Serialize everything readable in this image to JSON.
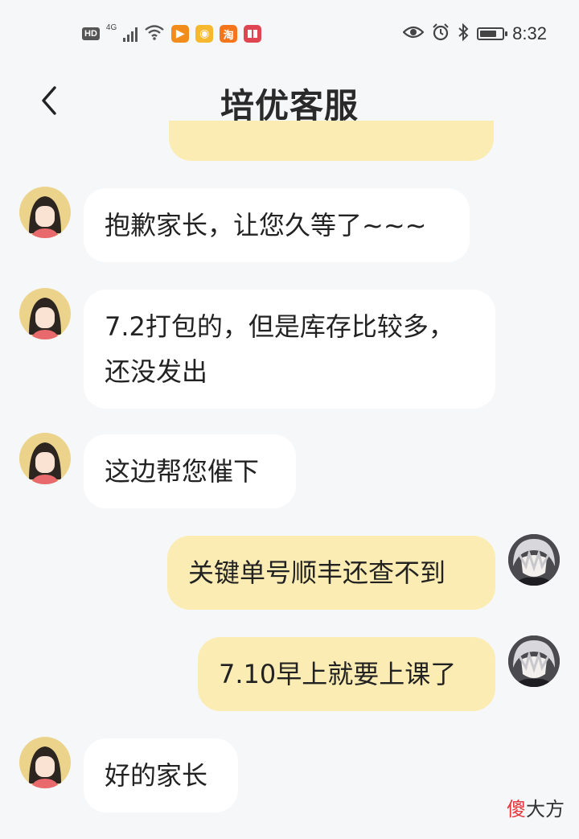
{
  "status_bar": {
    "hd_label": "HD",
    "network_label": "4G",
    "app_icons": [
      {
        "name": "video-app-icon",
        "color": "#f28c1b",
        "glyph": "▶"
      },
      {
        "name": "weibo-icon",
        "color": "#f5b82e",
        "glyph": "◉"
      },
      {
        "name": "taobao-icon",
        "color": "#f5761a",
        "glyph": "淘"
      },
      {
        "name": "reader-app-icon",
        "color": "#e04552",
        "glyph": "▮"
      }
    ],
    "time": "8:32"
  },
  "header": {
    "title": "培优客服",
    "back_icon": "chevron-left-icon"
  },
  "messages": [
    {
      "side": "left",
      "text": "抱歉家长，让您久等了~~~"
    },
    {
      "side": "left",
      "text": "7.2打包的，但是库存比较多，还没发出"
    },
    {
      "side": "left",
      "text": "这边帮您催下"
    },
    {
      "side": "right",
      "text": "关键单号顺丰还查不到"
    },
    {
      "side": "right",
      "text": "7.10早上就要上课了"
    },
    {
      "side": "left",
      "text": "好的家长"
    }
  ],
  "watermark": {
    "part1": "傻",
    "part2": "大方"
  },
  "colors": {
    "background": "#f6f7f9",
    "incoming_bubble": "#ffffff",
    "outgoing_bubble": "#fbecb3",
    "text": "#222222"
  }
}
